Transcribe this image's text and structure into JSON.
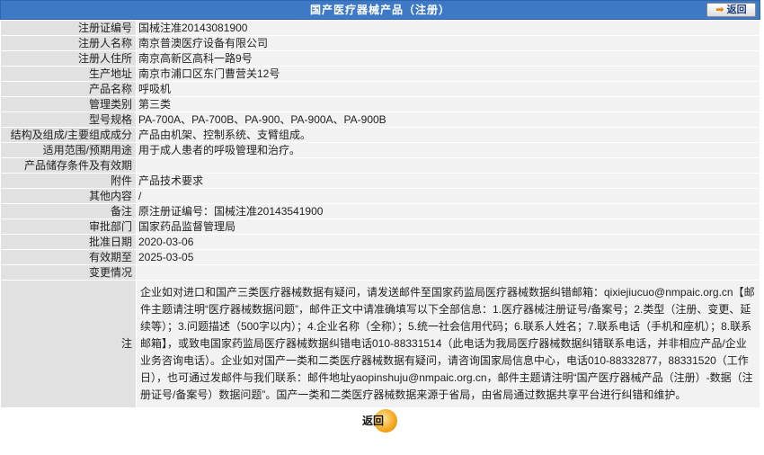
{
  "header": {
    "title": "国产医疗器械产品（注册）",
    "back_label": "返回",
    "back_icon": "arrow-right-icon"
  },
  "rows": [
    {
      "label": "注册证编号",
      "value": "国械注准20143081900"
    },
    {
      "label": "注册人名称",
      "value": "南京普澳医疗设备有限公司"
    },
    {
      "label": "注册人住所",
      "value": "南京高新区高科一路9号"
    },
    {
      "label": "生产地址",
      "value": "南京市浦口区东门曹营关12号"
    },
    {
      "label": "产品名称",
      "value": "呼吸机"
    },
    {
      "label": "管理类别",
      "value": "第三类"
    },
    {
      "label": "型号规格",
      "value": "PA-700A、PA-700B、PA-900、PA-900A、PA-900B"
    },
    {
      "label": "结构及组成/主要组成成分",
      "value": "产品由机架、控制系统、支臂组成。"
    },
    {
      "label": "适用范围/预期用途",
      "value": "用于成人患者的呼吸管理和治疗。"
    },
    {
      "label": "产品储存条件及有效期",
      "value": ""
    },
    {
      "label": "附件",
      "value": "产品技术要求"
    },
    {
      "label": "其他内容",
      "value": "/"
    },
    {
      "label": "备注",
      "value": "原注册证编号：国械注准20143541900"
    },
    {
      "label": "审批部门",
      "value": "国家药品监督管理局"
    },
    {
      "label": "批准日期",
      "value": "2020-03-06"
    },
    {
      "label": "有效期至",
      "value": "2025-03-05"
    },
    {
      "label": "变更情况",
      "value": ""
    }
  ],
  "note": {
    "label": "注",
    "text": "企业如对进口和国产三类医疗器械数据有疑问，请发送邮件至国家药监局医疗器械数据纠错邮箱：qixiejiucuo@nmpaic.org.cn【邮件主题请注明“医疗器械数据问题”，邮件正文中请准确填写以下全部信息：1.医疗器械注册证号/备案号；2.类型（注册、变更、延续等）；3.问题描述（500字以内）；4.企业名称（全称）；5.统一社会信用代码；6.联系人姓名；7.联系电话（手机和座机）；8.联系邮箱】，或致电国家药监局医疗器械数据纠错电话010-88331514（此电话为我局医疗器械数据纠错联系电话，并非相应产品/企业业务咨询电话）。企业如对国产一类和二类医疗器械数据有疑问，请咨询国家局信息中心，电话010-88332877，88331520（工作日），也可通过发邮件与我们联系：邮件地址yaopinshuju@nmpaic.org.cn，邮件主题请注明“国产医疗器械产品（注册）-数据（注册证号/备案号）数据问题”。国产一类和二类医疗器械数据来源于省局，由省局通过数据共享平台进行纠错和维护。"
  },
  "footer": {
    "back_label": "返回"
  }
}
